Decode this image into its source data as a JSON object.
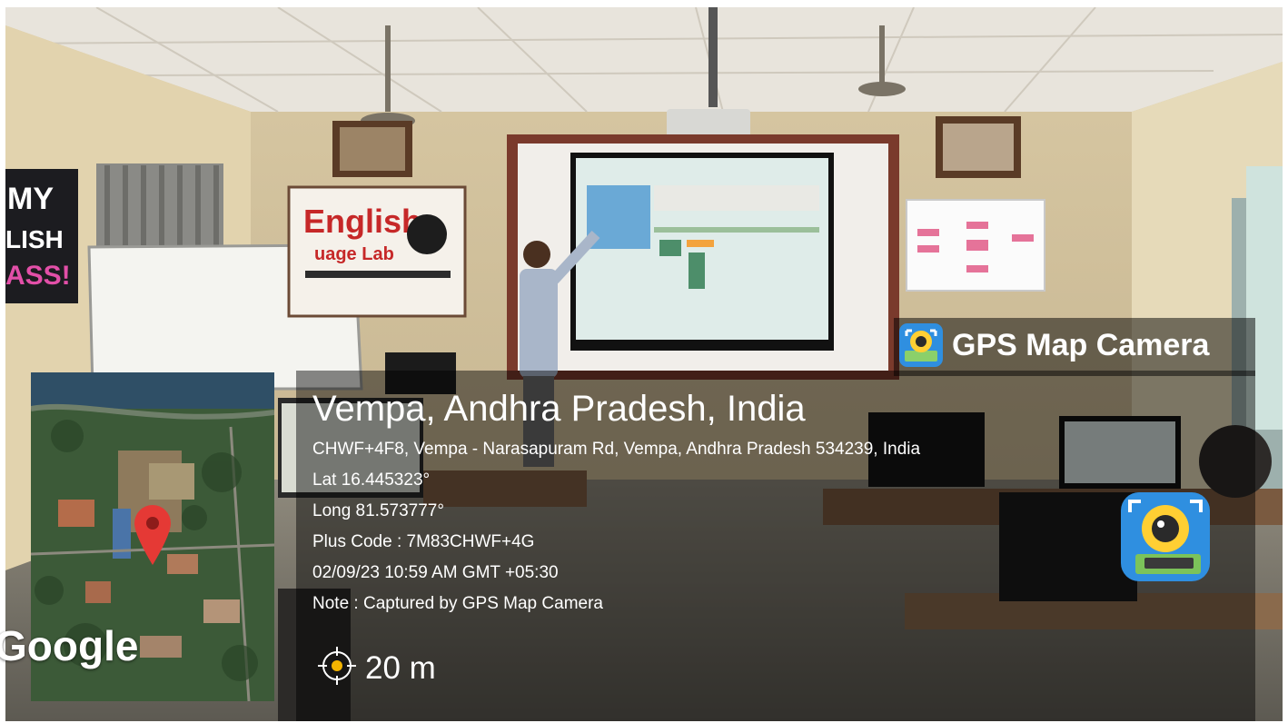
{
  "overlay": {
    "app_name": "GPS Map Camera",
    "place": "Vempa, Andhra Pradesh, India",
    "address": "CHWF+4F8, Vempa - Narasapuram Rd, Vempa, Andhra Pradesh 534239, India",
    "latitude": "Lat 16.445323°",
    "longitude": "Long 81.573777°",
    "plus_code": "Plus Code : 7M83CHWF+4G",
    "datetime": "02/09/23 10:59 AM GMT +05:30",
    "note": "Note : Captured by GPS Map Camera",
    "accuracy": "20 m",
    "map_provider": "Google"
  },
  "scene": {
    "lab_sign": {
      "line1": "English",
      "line2": "uage Lab"
    },
    "wall_banner": [
      "MY",
      "LISH",
      "ASS!"
    ]
  },
  "colors": {
    "overlay_bg": "#000000",
    "pin": "#e53935",
    "accuracy_ring": "#f4b400",
    "app_icon": "#2f8fe0"
  },
  "icons": [
    "map-pin-icon",
    "gps-target-icon",
    "gps-map-camera-app-icon",
    "gps-map-camera-logo-icon"
  ]
}
